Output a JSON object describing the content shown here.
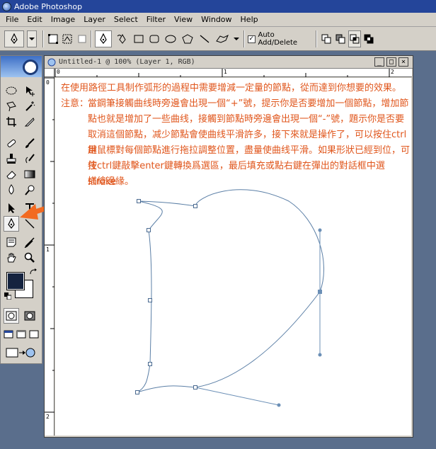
{
  "app": {
    "title": "Adobe Photoshop",
    "icon": "photoshop-icon"
  },
  "menu": {
    "items": [
      "File",
      "Edit",
      "Image",
      "Layer",
      "Select",
      "Filter",
      "View",
      "Window",
      "Help"
    ]
  },
  "options_bar": {
    "auto_add_delete_label": "Auto Add/Delete",
    "auto_add_delete_checked": "✓"
  },
  "document": {
    "title": "Untitled-1 @ 100% (Layer 1, RGB)",
    "ruler_top": [
      "0",
      "1",
      "2"
    ],
    "ruler_left": [
      "0",
      "1",
      "2"
    ]
  },
  "annotation": {
    "line1": "在使用路徑工具制作弧形的過程中需要增減一定量的節點，從而達到你想要的效果。",
    "note_label": "注意：",
    "lines": [
      "當鋼筆接觸曲线時旁邊會出現一個“+”號，提示你是否要增加一個節點，增加節",
      "點也就是增加了一些曲线，接觸到節點時旁邊會出現一個“-”號，題示你是否要",
      "取消這個節點，减少節點會使曲线平滑許多，接下來就是操作了，可以按住ctrl鍵",
      "用鼠標對每個節點進行拖拉調整位置，盡量使曲线平滑。如果形狀已經到位，可按",
      "住ctrl鍵敲擊enter鍵轉換爲選區，最后填充或點右鍵在彈出的對話框中選stroke",
      "描繪邊緣。"
    ]
  },
  "colors": {
    "foreground": "#15233f",
    "background": "#ffffff",
    "accent_arrow": "#f26a21",
    "annotation_text": "#e0561c"
  }
}
